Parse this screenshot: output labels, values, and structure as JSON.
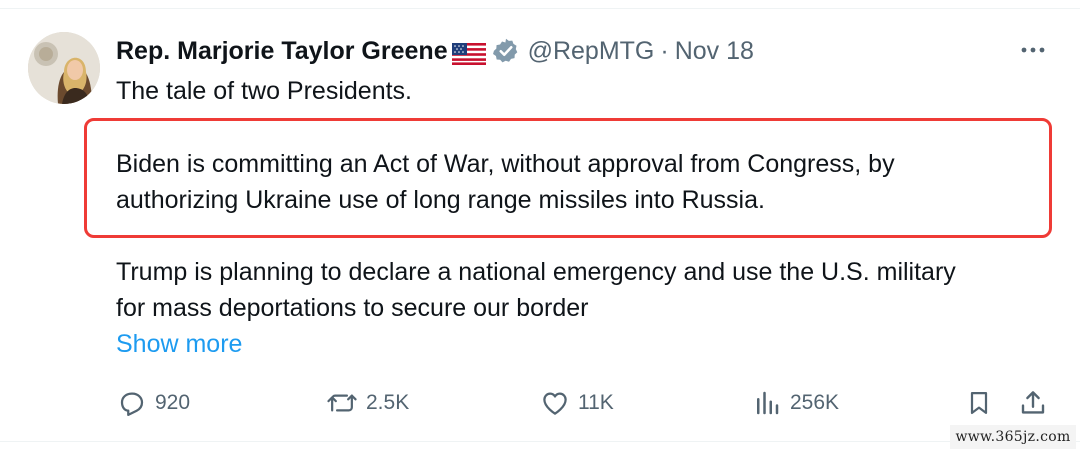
{
  "tweet": {
    "author": {
      "display_name": "Rep. Marjorie Taylor Greene",
      "handle": "@RepMTG",
      "separator": "·",
      "date": "Nov 18",
      "flag_icon": "us-flag-icon",
      "verified_icon": "verified-badge-icon"
    },
    "text": {
      "line1": "The tale of two Presidents.",
      "quote_line1": "Biden is committing an Act of War, without approval from Congress, by",
      "quote_line2": "authorizing Ukraine use of long range missiles into Russia.",
      "para2_line1": "Trump is planning to declare a national emergency and use the U.S. military",
      "para2_line2": "for mass deportations to secure our border",
      "show_more": "Show more"
    },
    "highlight_color": "#ef3b36",
    "link_color": "#1d9bf0",
    "actions": {
      "reply": {
        "icon": "reply-icon",
        "count": "920"
      },
      "repost": {
        "icon": "repost-icon",
        "count": "2.5K"
      },
      "like": {
        "icon": "like-icon",
        "count": "11K"
      },
      "views": {
        "icon": "views-icon",
        "count": "256K"
      },
      "bookmark": {
        "icon": "bookmark-icon"
      },
      "share": {
        "icon": "share-icon"
      }
    }
  },
  "watermark": "www.365jz.com"
}
